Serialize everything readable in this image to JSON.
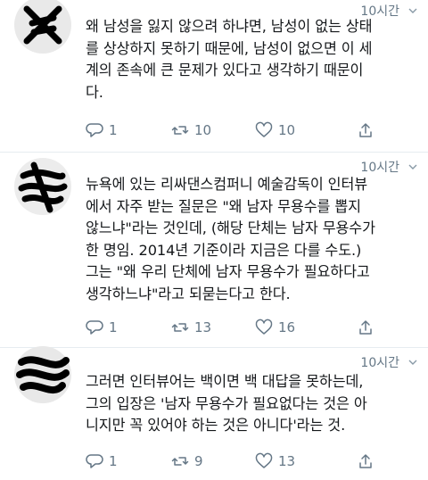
{
  "tweets": [
    {
      "time": "10시간",
      "lines": [
        "왜 남성을 잃지 않으려 하냐면, 남성이 없는 상태",
        "를 상상하지 못하기 때문에, 남성이 없으면 이 세",
        "계의 존속에 큰 문제가 있다고 생각하기 때문이",
        "다."
      ],
      "reply_count": "1",
      "retweet_count": "10",
      "like_count": "10"
    },
    {
      "time": "10시간",
      "lines": [
        "뉴욕에 있는 리싸댄스컴퍼니 예술감독이 인터뷰",
        "에서 자주 받는 질문은 \"왜 남자 무용수를 뽑지",
        "않느냐\"라는 것인데, (해당 단체는 남자 무용수가",
        "한 명임. 2014년 기준이라 지금은 다를 수도.)",
        "그는 \"왜 우리 단체에 남자 무용수가 필요하다고",
        "생각하느냐\"라고 되묻는다고 한다."
      ],
      "reply_count": "1",
      "retweet_count": "13",
      "like_count": "16"
    },
    {
      "time": "10시간",
      "lines": [
        "그러면 인터뷰어는 백이면 백 대답을 못하는데,",
        "그의 입장은 '남자 무용수가 필요없다는 것은 아",
        "니지만 꼭 있어야 하는 것은 아니다'라는 것."
      ],
      "reply_count": "1",
      "retweet_count": "9",
      "like_count": "13"
    }
  ],
  "colors": {
    "text": "#14171a",
    "muted": "#657786",
    "divider": "#e6ecf0"
  }
}
